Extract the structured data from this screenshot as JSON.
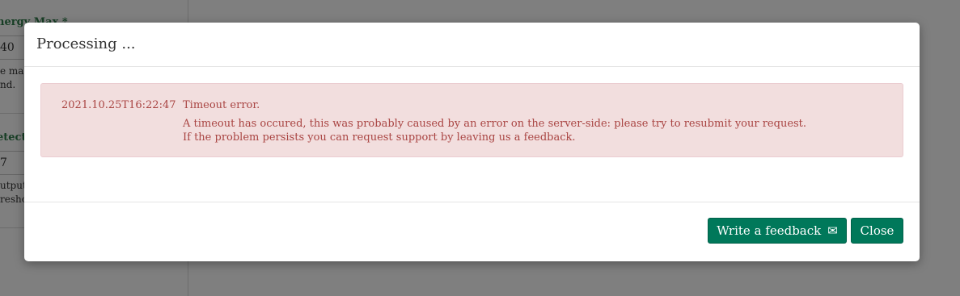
{
  "background": {
    "fields": [
      {
        "label": "nergy Max *",
        "value": "40",
        "help": [
          "e ma",
          "nd."
        ]
      },
      {
        "label": "etect",
        "value": "7",
        "help": [
          "utput",
          "resho"
        ]
      }
    ]
  },
  "modal": {
    "title": "Processing ...",
    "alert": {
      "timestamp": "2021.10.25T16:22:47",
      "title": "Timeout error.",
      "message_line1": "A timeout has occured, this was probably caused by an error on the server-side: please try to resubmit your request.",
      "message_line2": "If the problem persists you can request support by leaving us a feedback."
    },
    "buttons": {
      "feedback_label": "Write a feedback",
      "feedback_icon": "envelope-icon",
      "close_label": "Close"
    }
  },
  "colors": {
    "primary_button": "#00785a",
    "alert_bg": "#f2dede",
    "alert_text": "#a94442",
    "label_green": "#2e7d4a"
  }
}
